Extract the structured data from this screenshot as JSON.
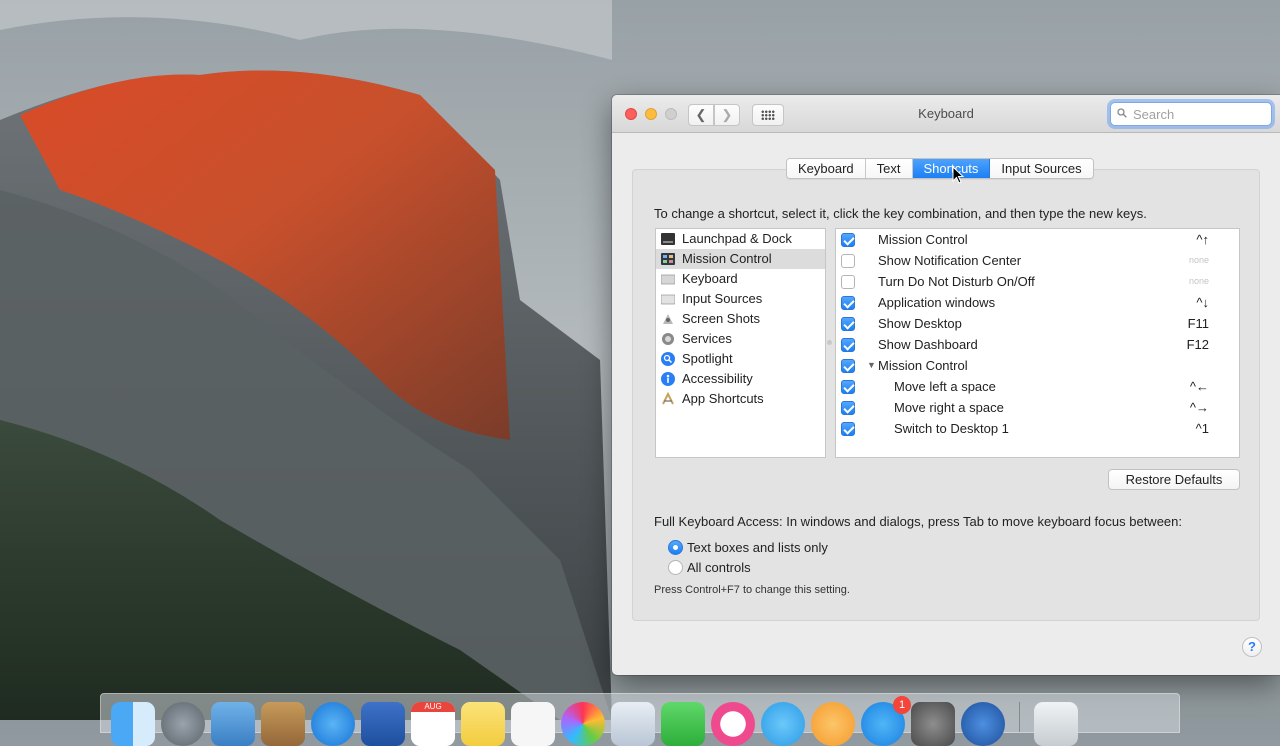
{
  "window": {
    "title": "Keyboard",
    "search_placeholder": "Search"
  },
  "tabs": [
    {
      "label": "Keyboard",
      "active": false
    },
    {
      "label": "Text",
      "active": false
    },
    {
      "label": "Shortcuts",
      "active": true
    },
    {
      "label": "Input Sources",
      "active": false
    }
  ],
  "instructions": "To change a shortcut, select it, click the key combination, and then type the new keys.",
  "categories": [
    {
      "label": "Launchpad & Dock",
      "icon": "launchpad-icon"
    },
    {
      "label": "Mission Control",
      "icon": "mission-control-icon",
      "selected": true
    },
    {
      "label": "Keyboard",
      "icon": "keyboard-icon"
    },
    {
      "label": "Input Sources",
      "icon": "input-sources-icon"
    },
    {
      "label": "Screen Shots",
      "icon": "screenshot-icon"
    },
    {
      "label": "Services",
      "icon": "services-gear-icon"
    },
    {
      "label": "Spotlight",
      "icon": "spotlight-icon"
    },
    {
      "label": "Accessibility",
      "icon": "accessibility-icon"
    },
    {
      "label": "App Shortcuts",
      "icon": "app-shortcuts-icon"
    }
  ],
  "shortcuts": [
    {
      "label": "Mission Control",
      "checked": true,
      "key": "^↑"
    },
    {
      "label": "Show Notification Center",
      "checked": false,
      "key": "none"
    },
    {
      "label": "Turn Do Not Disturb On/Off",
      "checked": false,
      "key": "none"
    },
    {
      "label": "Application windows",
      "checked": true,
      "key": "^↓"
    },
    {
      "label": "Show Desktop",
      "checked": true,
      "key": "F11"
    },
    {
      "label": "Show Dashboard",
      "checked": true,
      "key": "F12"
    },
    {
      "label": "Mission Control",
      "checked": true,
      "key": "",
      "expanded": true
    },
    {
      "label": "Move left a space",
      "checked": true,
      "key": "^←",
      "indent": true
    },
    {
      "label": "Move right a space",
      "checked": true,
      "key": "^→",
      "indent": true
    },
    {
      "label": "Switch to Desktop 1",
      "checked": true,
      "key": "^1",
      "indent": true
    }
  ],
  "restore_defaults": "Restore Defaults",
  "keyboard_access": {
    "label": "Full Keyboard Access: In windows and dialogs, press Tab to move keyboard focus between:",
    "options": [
      {
        "label": "Text boxes and lists only",
        "selected": true
      },
      {
        "label": "All controls",
        "selected": false
      }
    ],
    "note": "Press Control+F7 to change this setting."
  },
  "help": "?",
  "dock": {
    "calendar_month": "AUG",
    "app_store_badge": "1"
  }
}
